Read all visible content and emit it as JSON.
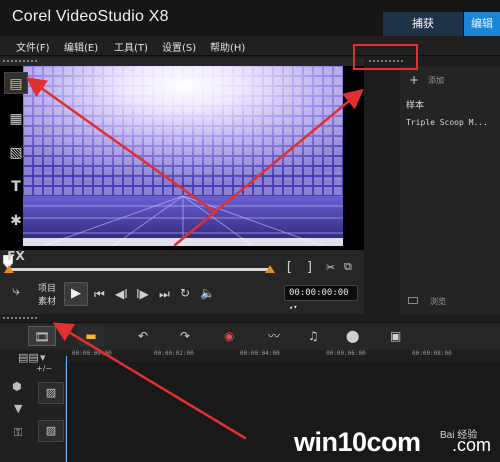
{
  "app": {
    "title": "Corel VideoStudio X8"
  },
  "mode_tabs": [
    {
      "label": "捕获"
    },
    {
      "label": "编辑"
    }
  ],
  "menu": [
    {
      "label": "文件(F)"
    },
    {
      "label": "编辑(E)"
    },
    {
      "label": "工具(T)"
    },
    {
      "label": "设置(S)"
    },
    {
      "label": "帮助(H)"
    }
  ],
  "player": {
    "mode_project": "项目",
    "mode_clip": "素材",
    "timecode": "00:00:00:00",
    "mark_in": "[",
    "mark_out": "]"
  },
  "library": {
    "add_label": "添加",
    "items": [
      {
        "label": "样本"
      },
      {
        "label": "Triple Scoop M..."
      }
    ],
    "browse_label": "浏览"
  },
  "timeline": {
    "ruler": [
      "00:00:00:00",
      "00:00:02:00",
      "00:00:04:00",
      "00:00:06:00",
      "00:00:08:00"
    ]
  },
  "watermark": {
    "text": "win10com",
    "suffix": ".com",
    "logo_text": "Bai 经验"
  },
  "colors": {
    "accent": "#1b86d8",
    "annotation": "#e0302f",
    "marker": "#e58b2a"
  },
  "icons": [
    "play-icon",
    "folder-icon",
    "add-icon",
    "text-icon",
    "fx-icon",
    "undo-icon",
    "redo-icon",
    "record-icon",
    "audio-wave-icon"
  ]
}
